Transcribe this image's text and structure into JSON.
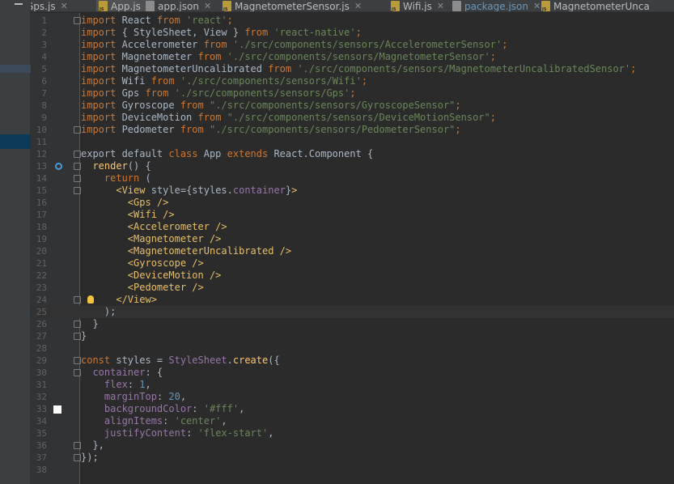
{
  "tabs": [
    {
      "label": "Gps.js",
      "type": "js",
      "active": false,
      "blue": false
    },
    {
      "label": "App.js",
      "type": "js",
      "active": true,
      "blue": false
    },
    {
      "label": "app.json",
      "type": "json",
      "active": false,
      "blue": false
    },
    {
      "label": "MagnetometerSensor.js",
      "type": "js",
      "active": false,
      "blue": false
    },
    {
      "label": "Wifi.js",
      "type": "js",
      "active": false,
      "blue": false
    },
    {
      "label": "package.json",
      "type": "json",
      "active": false,
      "blue": true
    },
    {
      "label": "MagnetometerUnca",
      "type": "js",
      "active": false,
      "blue": false
    }
  ],
  "editor": {
    "caret_line": 25,
    "lines": [
      {
        "n": "1",
        "tokens": [
          [
            "kw",
            "import"
          ],
          [
            "plain",
            " React "
          ],
          [
            "kw",
            "from"
          ],
          [
            "str",
            " 'react'"
          ],
          [
            "kw",
            ";"
          ]
        ]
      },
      {
        "n": "2",
        "tokens": [
          [
            "kw",
            "import"
          ],
          [
            "plain",
            " { StyleSheet, View } "
          ],
          [
            "kw",
            "from"
          ],
          [
            "str",
            " 'react-native'"
          ],
          [
            "kw",
            ";"
          ]
        ]
      },
      {
        "n": "3",
        "tokens": [
          [
            "kw",
            "import"
          ],
          [
            "plain",
            " Accelerometer "
          ],
          [
            "kw",
            "from"
          ],
          [
            "str",
            " './src/components/sensors/AccelerometerSensor'"
          ],
          [
            "kw",
            ";"
          ]
        ]
      },
      {
        "n": "4",
        "tokens": [
          [
            "kw",
            "import"
          ],
          [
            "plain",
            " Magnetometer "
          ],
          [
            "kw",
            "from"
          ],
          [
            "str",
            " './src/components/sensors/MagnetometerSensor'"
          ],
          [
            "kw",
            ";"
          ]
        ]
      },
      {
        "n": "5",
        "tokens": [
          [
            "kw",
            "import"
          ],
          [
            "plain",
            " MagnetometerUncalibrated "
          ],
          [
            "kw",
            "from"
          ],
          [
            "str",
            " './src/components/sensors/MagnetometerUncalibratedSensor'"
          ],
          [
            "kw",
            ";"
          ]
        ]
      },
      {
        "n": "6",
        "tokens": [
          [
            "kw",
            "import"
          ],
          [
            "plain",
            " Wifi "
          ],
          [
            "kw",
            "from"
          ],
          [
            "str",
            " './src/components/sensors/Wifi'"
          ],
          [
            "kw",
            ";"
          ]
        ]
      },
      {
        "n": "7",
        "tokens": [
          [
            "kw",
            "import"
          ],
          [
            "plain",
            " Gps "
          ],
          [
            "kw",
            "from"
          ],
          [
            "str",
            " './src/components/sensors/Gps'"
          ],
          [
            "kw",
            ";"
          ]
        ]
      },
      {
        "n": "8",
        "tokens": [
          [
            "kw",
            "import"
          ],
          [
            "plain",
            " Gyroscope "
          ],
          [
            "kw",
            "from"
          ],
          [
            "str",
            " \"./src/components/sensors/GyroscopeSensor\""
          ],
          [
            "kw",
            ";"
          ]
        ]
      },
      {
        "n": "9",
        "tokens": [
          [
            "kw",
            "import"
          ],
          [
            "plain",
            " DeviceMotion "
          ],
          [
            "kw",
            "from"
          ],
          [
            "str",
            " \"./src/components/sensors/DeviceMotionSensor\""
          ],
          [
            "kw",
            ";"
          ]
        ]
      },
      {
        "n": "10",
        "tokens": [
          [
            "kw",
            "import"
          ],
          [
            "plain",
            " Pedometer "
          ],
          [
            "kw",
            "from"
          ],
          [
            "str",
            " \"./src/components/sensors/PedometerSensor\""
          ],
          [
            "kw",
            ";"
          ]
        ]
      },
      {
        "n": "11",
        "tokens": []
      },
      {
        "n": "12",
        "tokens": [
          [
            "plain",
            "export default "
          ],
          [
            "kw",
            "class "
          ],
          [
            "plain",
            "App "
          ],
          [
            "kw",
            "extends "
          ],
          [
            "plain",
            "React.Component {"
          ]
        ]
      },
      {
        "n": "13",
        "tokens": [
          [
            "plain",
            "  "
          ],
          [
            "fn",
            "render"
          ],
          [
            "plain",
            "() {"
          ]
        ]
      },
      {
        "n": "14",
        "tokens": [
          [
            "plain",
            "    "
          ],
          [
            "kw",
            "return"
          ],
          [
            "plain",
            " ("
          ]
        ]
      },
      {
        "n": "15",
        "tokens": [
          [
            "plain",
            "      "
          ],
          [
            "tag",
            "<View "
          ],
          [
            "plain",
            "style={styles."
          ],
          [
            "prop",
            "container"
          ],
          [
            "plain",
            "}"
          ],
          [
            "tag",
            ">"
          ]
        ]
      },
      {
        "n": "16",
        "tokens": [
          [
            "plain",
            "        "
          ],
          [
            "tag",
            "<Gps />"
          ]
        ]
      },
      {
        "n": "17",
        "tokens": [
          [
            "plain",
            "        "
          ],
          [
            "tag",
            "<Wifi />"
          ]
        ]
      },
      {
        "n": "18",
        "tokens": [
          [
            "plain",
            "        "
          ],
          [
            "tag",
            "<Accelerometer />"
          ]
        ]
      },
      {
        "n": "19",
        "tokens": [
          [
            "plain",
            "        "
          ],
          [
            "tag",
            "<Magnetometer />"
          ]
        ]
      },
      {
        "n": "20",
        "tokens": [
          [
            "plain",
            "        "
          ],
          [
            "tag",
            "<MagnetometerUncalibrated />"
          ]
        ]
      },
      {
        "n": "21",
        "tokens": [
          [
            "plain",
            "        "
          ],
          [
            "tag",
            "<Gyroscope />"
          ]
        ]
      },
      {
        "n": "22",
        "tokens": [
          [
            "plain",
            "        "
          ],
          [
            "tag",
            "<DeviceMotion />"
          ]
        ]
      },
      {
        "n": "23",
        "tokens": [
          [
            "plain",
            "        "
          ],
          [
            "tag",
            "<Pedometer />"
          ]
        ]
      },
      {
        "n": "24",
        "tokens": [
          [
            "plain",
            "      "
          ],
          [
            "tag",
            "</View>"
          ]
        ]
      },
      {
        "n": "25",
        "tokens": [
          [
            "plain",
            "    );"
          ]
        ]
      },
      {
        "n": "26",
        "tokens": [
          [
            "plain",
            "  }"
          ]
        ]
      },
      {
        "n": "27",
        "tokens": [
          [
            "plain",
            "}"
          ]
        ]
      },
      {
        "n": "28",
        "tokens": []
      },
      {
        "n": "29",
        "tokens": [
          [
            "kw",
            "const "
          ],
          [
            "plain",
            "styles = "
          ],
          [
            "prop",
            "StyleSheet"
          ],
          [
            "plain",
            "."
          ],
          [
            "fn",
            "create"
          ],
          [
            "plain",
            "({"
          ]
        ]
      },
      {
        "n": "30",
        "tokens": [
          [
            "plain",
            "  "
          ],
          [
            "prop",
            "container"
          ],
          [
            "plain",
            ": {"
          ]
        ]
      },
      {
        "n": "31",
        "tokens": [
          [
            "plain",
            "    "
          ],
          [
            "prop",
            "flex"
          ],
          [
            "plain",
            ": "
          ],
          [
            "num",
            "1"
          ],
          [
            "plain",
            ","
          ]
        ]
      },
      {
        "n": "32",
        "tokens": [
          [
            "plain",
            "    "
          ],
          [
            "prop",
            "marginTop"
          ],
          [
            "plain",
            ": "
          ],
          [
            "num",
            "20"
          ],
          [
            "plain",
            ","
          ]
        ]
      },
      {
        "n": "33",
        "tokens": [
          [
            "plain",
            "    "
          ],
          [
            "prop",
            "backgroundColor"
          ],
          [
            "plain",
            ": "
          ],
          [
            "str",
            "'#fff'"
          ],
          [
            "plain",
            ","
          ]
        ]
      },
      {
        "n": "34",
        "tokens": [
          [
            "plain",
            "    "
          ],
          [
            "prop",
            "alignItems"
          ],
          [
            "plain",
            ": "
          ],
          [
            "str",
            "'center'"
          ],
          [
            "plain",
            ","
          ]
        ]
      },
      {
        "n": "35",
        "tokens": [
          [
            "plain",
            "    "
          ],
          [
            "prop",
            "justifyContent"
          ],
          [
            "plain",
            ": "
          ],
          [
            "str",
            "'flex-start'"
          ],
          [
            "plain",
            ","
          ]
        ]
      },
      {
        "n": "36",
        "tokens": [
          [
            "plain",
            "  },"
          ]
        ]
      },
      {
        "n": "37",
        "tokens": [
          [
            "plain",
            "});"
          ]
        ]
      },
      {
        "n": "38",
        "tokens": []
      }
    ]
  },
  "colors": {
    "background": "#2b2b2b",
    "keyword": "#cc7832",
    "string": "#6a8759",
    "tag": "#e8bf6a",
    "property": "#9876aa",
    "number": "#6897bb",
    "function": "#ffc66d",
    "text": "#a9b7c6"
  },
  "gutter_icons": {
    "13": "override-method-icon",
    "24": "lightbulb-icon",
    "33": "color-swatch-icon"
  }
}
